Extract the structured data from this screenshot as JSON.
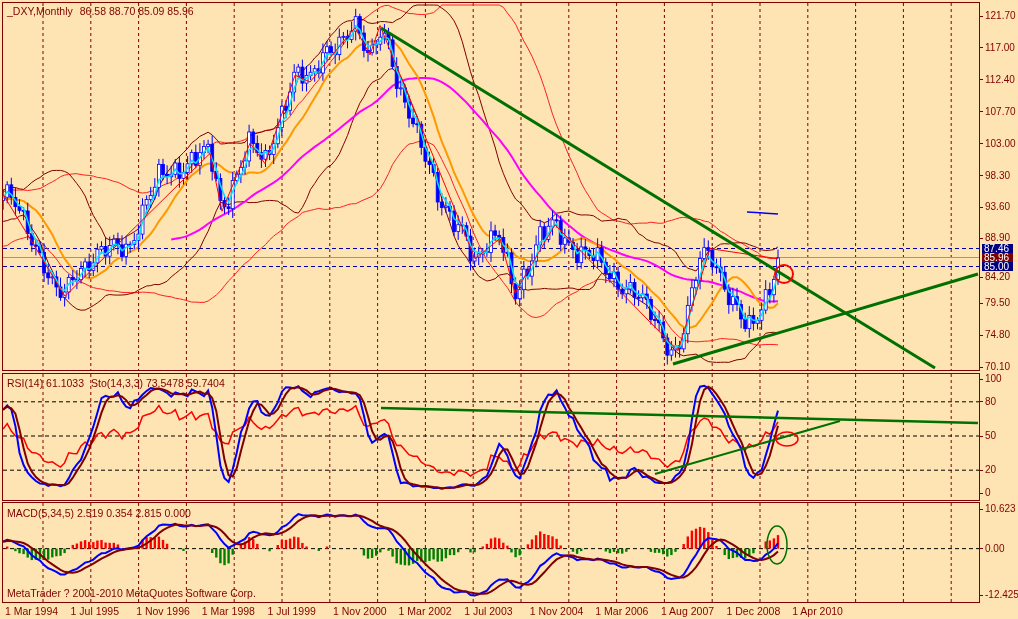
{
  "price_chart": {
    "symbol": "_DXY,Monthly",
    "ohlc": "86.58 88.70 85.09 85.96",
    "price_axis": [
      "121.70",
      "117.00",
      "112.40",
      "107.70",
      "103.00",
      "98.30",
      "93.60",
      "88.90",
      "84.20",
      "79.50",
      "74.80",
      "70.10"
    ],
    "price_tags": [
      {
        "kind": "line",
        "text": "87.46"
      },
      {
        "kind": "bid",
        "text": "85.96"
      },
      {
        "kind": "line",
        "text": "85.00"
      }
    ]
  },
  "oscillator_panel": {
    "rsi_label": "RSI(14) 61.1033",
    "stochastic_label": "Sto(14,3,3) 73.5478 59.7404",
    "axis": [
      "100",
      "80",
      "50",
      "20",
      "0"
    ]
  },
  "macd_panel": {
    "label": "MACD(5,34,5) 2.519 0.354 2.815 0.000",
    "copyright": "MetaTrader ? 2001-2010 MetaQuotes Software Corp.",
    "axis": [
      "10.623",
      "0.00",
      "-12.425"
    ]
  },
  "time_axis": [
    "1 Mar 1994",
    "1 Jul 1995",
    "1 Nov 1996",
    "1 Mar 1998",
    "1 Jul 1999",
    "1 Nov 2000",
    "1 Mar 2002",
    "1 Jul 2003",
    "1 Nov 2004",
    "1 Mar 2006",
    "1 Aug 2007",
    "1 Dec 2008",
    "1 Apr 2010"
  ]
}
